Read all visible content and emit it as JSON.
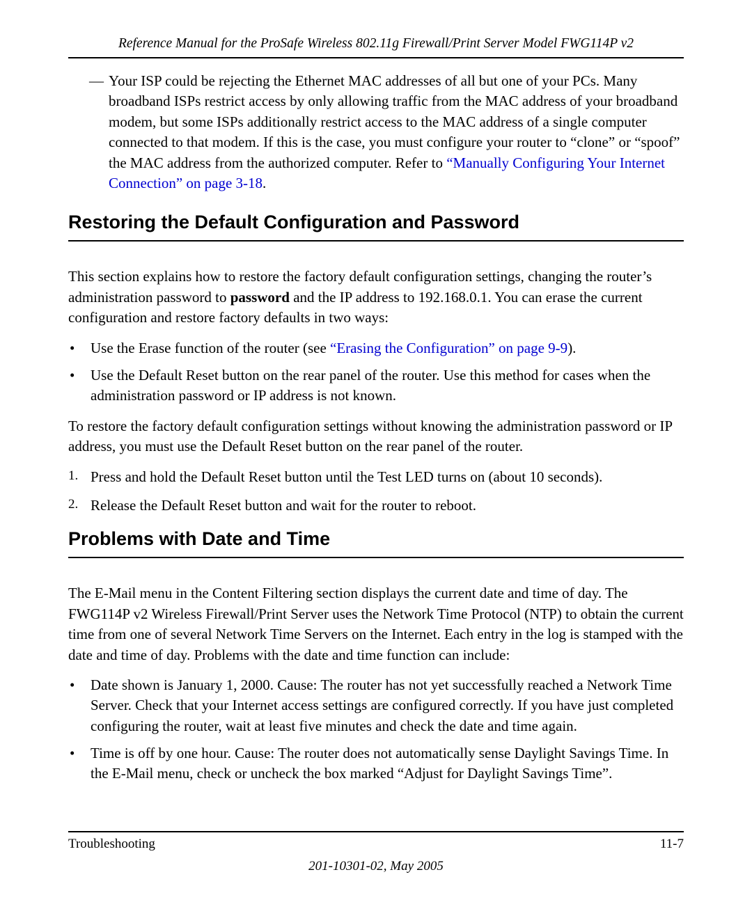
{
  "header": {
    "running_title": "Reference Manual for the ProSafe Wireless 802.11g  Firewall/Print Server Model FWG114P v2"
  },
  "dash_item": {
    "text_before_link": "Your ISP could be rejecting the Ethernet MAC addresses of all but one of your PCs. Many broadband ISPs restrict access by only allowing traffic from the MAC address of your broadband modem, but some ISPs additionally restrict access to the MAC address of a single computer connected to that modem. If this is the case, you must configure your router to “clone” or “spoof” the MAC address from the authorized computer. Refer to ",
    "link_text": "“Manually Configuring Your Internet Connection” on page 3-18",
    "text_after_link": "."
  },
  "section1": {
    "heading": "Restoring the Default Configuration and Password",
    "intro_before_bold": "This section explains how to restore the factory default configuration settings, changing the router’s administration password to ",
    "intro_bold": "password",
    "intro_after_bold": " and the IP address to 192.168.0.1. You can erase the current configuration and restore factory defaults in two ways:",
    "bullets": [
      {
        "pre": "Use the Erase function of the router (see ",
        "link": "“Erasing the Configuration” on page 9-9",
        "post": ")."
      },
      {
        "pre": "Use the Default Reset button on the rear panel of the router. Use this method for cases when the administration password or IP address is not known.",
        "link": "",
        "post": ""
      }
    ],
    "para2": "To restore the factory default configuration settings without knowing the administration password or IP address, you must use the Default Reset button on the rear panel of the router.",
    "steps": [
      "Press and hold the Default Reset button until the Test LED turns on (about 10 seconds).",
      "Release the Default Reset button and wait for the router to reboot."
    ]
  },
  "section2": {
    "heading": "Problems with Date and Time",
    "intro": "The E-Mail menu in the Content Filtering section displays the current date and time of day. The FWG114P v2 Wireless Firewall/Print Server uses the Network Time Protocol (NTP) to obtain the current time from one of several Network Time Servers on the Internet. Each entry in the log is stamped with the date and time of day. Problems with the date and time function can include:",
    "bullets": [
      "Date shown is January 1, 2000. Cause: The router has not yet successfully reached a Network Time Server. Check that your Internet access settings are configured correctly. If you have just completed configuring the router, wait at least five minutes and check the date and time again.",
      "Time is off by one hour. Cause: The router does not automatically sense Daylight Savings Time. In the E-Mail menu, check or uncheck the box marked “Adjust for Daylight Savings Time”."
    ]
  },
  "footer": {
    "section_name": "Troubleshooting",
    "page_number": "11-7",
    "doc_id": "201-10301-02, May 2005"
  }
}
